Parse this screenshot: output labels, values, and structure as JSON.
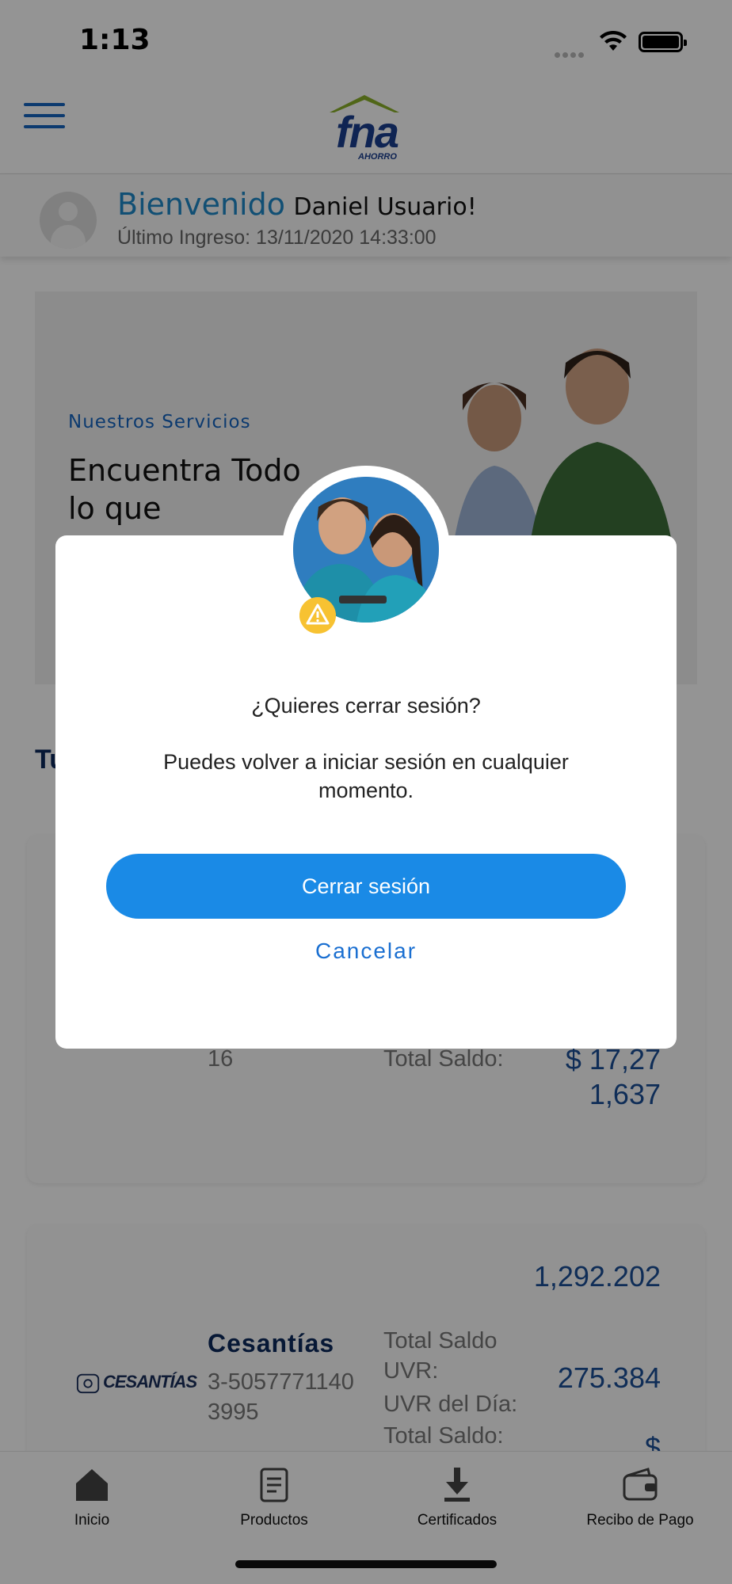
{
  "status_bar": {
    "time": "1:13"
  },
  "header": {
    "logo": {
      "wordmark": "fna",
      "sub": "AHORRO"
    }
  },
  "welcome": {
    "greeting": "Bienvenido",
    "name": "Daniel Usuario!",
    "last_login": "Último Ingreso: 13/11/2020 14:33:00"
  },
  "banner": {
    "kicker": "Nuestros Servicios",
    "title": "Encuentra Todo lo que"
  },
  "section": {
    "title_partial": "Tu"
  },
  "products": [
    {
      "account_fragment": "16",
      "total_label": "Total Saldo:",
      "total_value": "$ 17,271,637"
    },
    {
      "logo_text": "CESANTÍAS",
      "name": "Cesantías",
      "account": "3-50577711403995",
      "labels": [
        "Total Saldo UVR:",
        "UVR del Día:",
        "Total Saldo:"
      ],
      "values": [
        "1,292.202",
        "275.384",
        "$"
      ]
    }
  ],
  "tabbar": {
    "items": [
      {
        "label": "Inicio",
        "icon": "home-icon"
      },
      {
        "label": "Productos",
        "icon": "document-icon"
      },
      {
        "label": "Certificados",
        "icon": "download-icon"
      },
      {
        "label": "Recibo de Pago",
        "icon": "wallet-icon"
      }
    ]
  },
  "modal": {
    "question": "¿Quieres cerrar sesión?",
    "message": "Puedes volver a iniciar sesión en cualquier momento.",
    "primary_label": "Cerrar sesión",
    "secondary_label": "Cancelar",
    "colors": {
      "primary": "#1a8ae6",
      "link": "#1a6fd1"
    }
  }
}
